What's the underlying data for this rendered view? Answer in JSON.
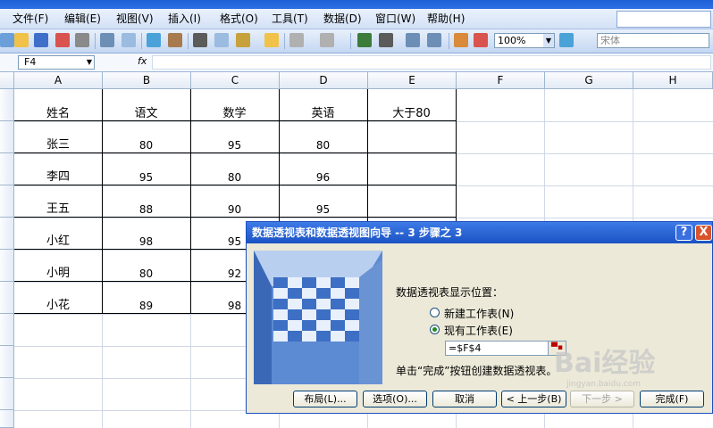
{
  "menu": {
    "items": [
      "文件(F)",
      "编辑(E)",
      "视图(V)",
      "插入(I)",
      "格式(O)",
      "工具(T)",
      "数据(D)",
      "窗口(W)",
      "帮助(H)"
    ]
  },
  "toolbar": {
    "zoom": "100%",
    "font": "宋体",
    "icons": [
      "new-icon",
      "open-icon",
      "save-icon",
      "permission-icon",
      "email-icon",
      "print-icon",
      "print-preview-icon",
      "spelling-icon",
      "research-icon",
      "cut-icon",
      "copy-icon",
      "paste-icon",
      "format-painter-icon",
      "undo-icon",
      "redo-icon",
      "hyperlink-icon",
      "autosum-icon",
      "sort-ascending-icon",
      "sort-descending-icon",
      "chart-wizard-icon",
      "drawing-icon",
      "help-icon"
    ]
  },
  "formula_bar": {
    "name_box": "F4",
    "fx": "fx"
  },
  "columns": [
    "A",
    "B",
    "C",
    "D",
    "E",
    "F",
    "G",
    "H"
  ],
  "table": {
    "headers": [
      "姓名",
      "语文",
      "数学",
      "英语",
      "大于80"
    ],
    "rows": [
      [
        "张三",
        "80",
        "95",
        "80",
        ""
      ],
      [
        "李四",
        "95",
        "80",
        "96",
        ""
      ],
      [
        "王五",
        "88",
        "90",
        "95",
        ""
      ],
      [
        "小红",
        "98",
        "95",
        "",
        ""
      ],
      [
        "小明",
        "80",
        "92",
        "",
        ""
      ],
      [
        "小花",
        "89",
        "98",
        "",
        ""
      ]
    ]
  },
  "dialog": {
    "title": "数据透视表和数据透视图向导 -- 3 步骤之 3",
    "help": "?",
    "close": "X",
    "position_label": "数据透视表显示位置：",
    "option_new": "新建工作表(N)",
    "option_existing": "现有工作表(E)",
    "reference": "=$F$4",
    "hint": "单击“完成”按钮创建数据透视表。",
    "buttons": {
      "layout": "布局(L)...",
      "options": "选项(O)...",
      "cancel": "取消",
      "back": "< 上一步(B)",
      "next": "下一步 >",
      "finish": "完成(F)"
    }
  },
  "watermark": {
    "text": "Bai经验",
    "sub": "jingyan.baidu.com"
  }
}
